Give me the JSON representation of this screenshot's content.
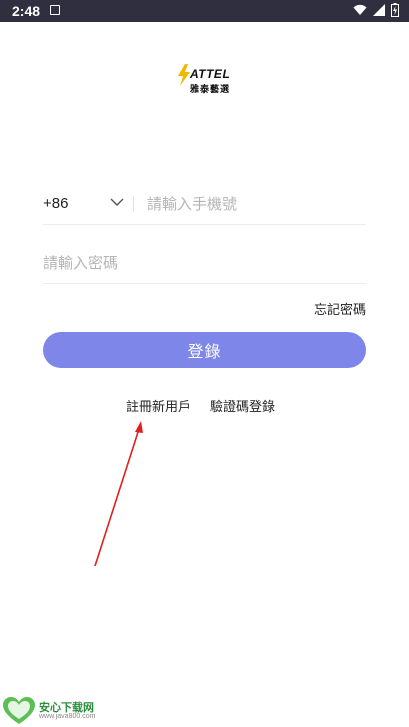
{
  "status_bar": {
    "time": "2:48"
  },
  "logo": {
    "wordmark": "ATTEL",
    "subtitle": "雅泰藝選"
  },
  "login_form": {
    "country_code": "+86",
    "phone_placeholder": "請輸入手機號",
    "password_placeholder": "請輸入密碼",
    "forgot_password": "忘記密碼",
    "login_button": "登錄",
    "register_link": "註冊新用戶",
    "sms_login_link": "驗證碼登錄"
  },
  "watermark": {
    "title": "安心下载网",
    "url": "www.java800.com"
  },
  "colors": {
    "status_bar": "#2f2f3f",
    "primary_button": "#7e86e9",
    "annotation_arrow": "#e02020",
    "watermark_green": "#2c8f3d"
  }
}
